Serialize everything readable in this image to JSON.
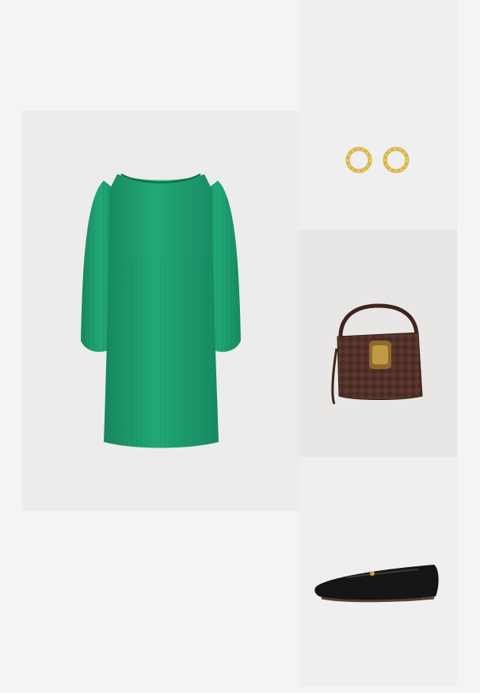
{
  "outfit": {
    "items": [
      {
        "id": "dress",
        "icon": "pleated-green-dress-image",
        "color": "#1f9e6f"
      },
      {
        "id": "earrings",
        "icon": "gold-hoop-earrings-image",
        "color": "#d4b04a"
      },
      {
        "id": "bag",
        "icon": "brown-woven-bucket-bag-image",
        "color": "#4a2c25"
      },
      {
        "id": "shoes",
        "icon": "black-ballet-flats-image",
        "color": "#151515"
      }
    ],
    "background": "#f4f4f4"
  }
}
